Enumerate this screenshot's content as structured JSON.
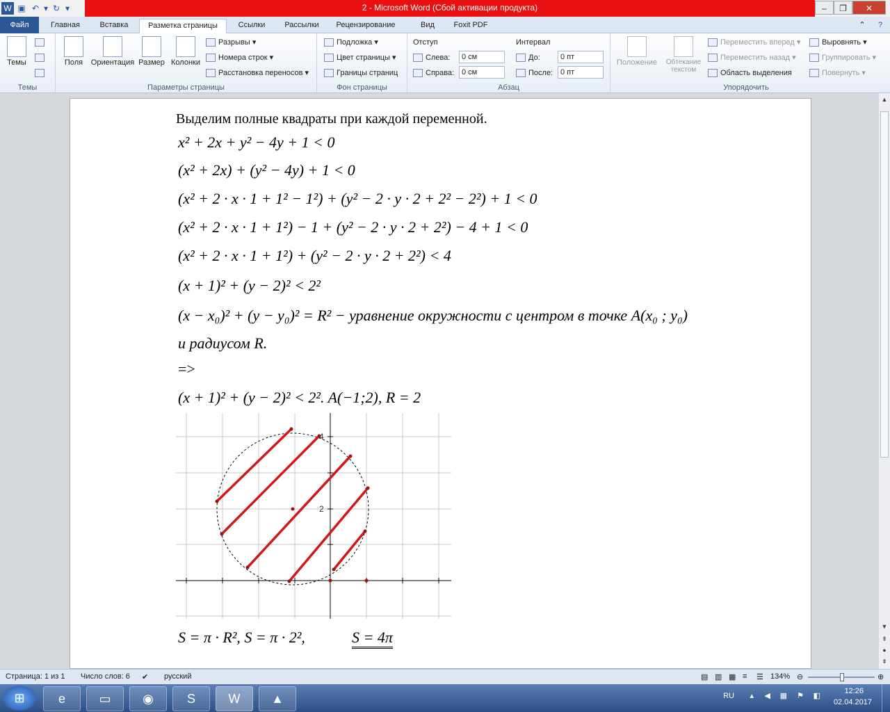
{
  "window": {
    "title": "2 - Microsoft Word (Сбой активации продукта)"
  },
  "tabs": [
    "Файл",
    "Главная",
    "Вставка",
    "Разметка страницы",
    "Ссылки",
    "Рассылки",
    "Рецензирование",
    "Вид",
    "Foxit PDF"
  ],
  "ribbon": {
    "themes": {
      "label": "Темы",
      "button": "Темы"
    },
    "page_setup": {
      "label": "Параметры страницы",
      "fields": "Поля",
      "orientation": "Ориентация",
      "size": "Размер",
      "columns": "Колонки",
      "breaks": "Разрывы",
      "line_numbers": "Номера строк",
      "hyphenation": "Расстановка переносов"
    },
    "background": {
      "label": "Фон страницы",
      "watermark": "Подложка",
      "page_color": "Цвет страницы",
      "page_borders": "Границы страниц"
    },
    "paragraph": {
      "label": "Абзац",
      "indent": "Отступ",
      "left": "Слева:",
      "right": "Справа:",
      "left_val": "0 см",
      "right_val": "0 см",
      "spacing": "Интервал",
      "before": "До:",
      "after": "После:",
      "before_val": "0 пт",
      "after_val": "0 пт"
    },
    "arrange": {
      "label": "Упорядочить",
      "position": "Положение",
      "wrap": "Обтекание текстом",
      "forward": "Переместить вперед",
      "backward": "Переместить назад",
      "selection": "Область выделения",
      "align": "Выровнять",
      "group": "Группировать",
      "rotate": "Повернуть"
    }
  },
  "document": {
    "heading": "Выделим полные квадраты при каждой переменной.",
    "lines": [
      "x² + 2x + y² − 4y + 1 < 0",
      "(x² + 2x) + (y² − 4y) + 1 < 0",
      "(x² + 2 · x · 1 + 1² − 1²) + (y² − 2 · y · 2 + 2² − 2²) + 1 < 0",
      "(x² + 2 · x · 1 + 1²) − 1 + (y² − 2 · y · 2 + 2²) − 4 + 1 < 0",
      "(x² + 2 · x · 1 + 1²) + (y² − 2 · y · 2 + 2²) < 4",
      "(x + 1)² + (y − 2)² < 2²",
      "(x − x₀)² + (y − y₀)² = R² − уравнение окружности с центром в точке A(x₀ ; y₀)",
      "и радиусом R.",
      "=>",
      "(x + 1)² + (y − 2)² < 2².    A(−1;2),    R = 2"
    ],
    "graph_labels": {
      "y4": "4",
      "y2": "2"
    },
    "final": "S = π · R²,    S = π · 2²,",
    "final_answer": "S = 4π"
  },
  "status": {
    "page": "Страница: 1 из 1",
    "words": "Число слов: 6",
    "lang": "русский",
    "zoom": "134%"
  },
  "taskbar": {
    "lang": "RU",
    "time": "12:26",
    "date": "02.04.2017"
  }
}
